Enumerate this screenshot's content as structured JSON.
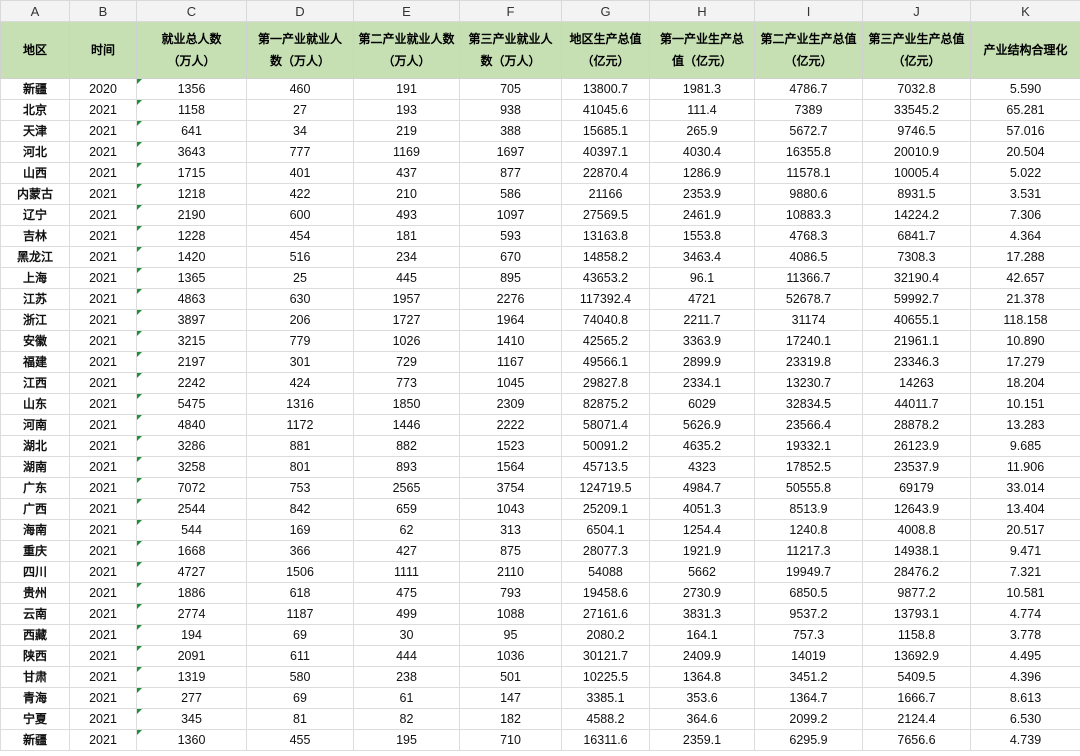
{
  "columns": [
    "A",
    "B",
    "C",
    "D",
    "E",
    "F",
    "G",
    "H",
    "I",
    "J",
    "K"
  ],
  "header": [
    [
      "地区"
    ],
    [
      "时间"
    ],
    [
      "就业总人数",
      "（万人）"
    ],
    [
      "第一产业就业人",
      "数（万人）"
    ],
    [
      "第二产业就业人数",
      "（万人）"
    ],
    [
      "第三产业就业人",
      "数（万人）"
    ],
    [
      "地区生产总值",
      "（亿元）"
    ],
    [
      "第一产业生产总",
      "值（亿元）"
    ],
    [
      "第二产业生产总值",
      "（亿元）"
    ],
    [
      "第三产业生产总值",
      "（亿元）"
    ],
    [
      "产业结构合理化"
    ]
  ],
  "rows": [
    [
      "新疆",
      "2020",
      "1356",
      "460",
      "191",
      "705",
      "13800.7",
      "1981.3",
      "4786.7",
      "7032.8",
      "5.590"
    ],
    [
      "北京",
      "2021",
      "1158",
      "27",
      "193",
      "938",
      "41045.6",
      "111.4",
      "7389",
      "33545.2",
      "65.281"
    ],
    [
      "天津",
      "2021",
      "641",
      "34",
      "219",
      "388",
      "15685.1",
      "265.9",
      "5672.7",
      "9746.5",
      "57.016"
    ],
    [
      "河北",
      "2021",
      "3643",
      "777",
      "1169",
      "1697",
      "40397.1",
      "4030.4",
      "16355.8",
      "20010.9",
      "20.504"
    ],
    [
      "山西",
      "2021",
      "1715",
      "401",
      "437",
      "877",
      "22870.4",
      "1286.9",
      "11578.1",
      "10005.4",
      "5.022"
    ],
    [
      "内蒙古",
      "2021",
      "1218",
      "422",
      "210",
      "586",
      "21166",
      "2353.9",
      "9880.6",
      "8931.5",
      "3.531"
    ],
    [
      "辽宁",
      "2021",
      "2190",
      "600",
      "493",
      "1097",
      "27569.5",
      "2461.9",
      "10883.3",
      "14224.2",
      "7.306"
    ],
    [
      "吉林",
      "2021",
      "1228",
      "454",
      "181",
      "593",
      "13163.8",
      "1553.8",
      "4768.3",
      "6841.7",
      "4.364"
    ],
    [
      "黑龙江",
      "2021",
      "1420",
      "516",
      "234",
      "670",
      "14858.2",
      "3463.4",
      "4086.5",
      "7308.3",
      "17.288"
    ],
    [
      "上海",
      "2021",
      "1365",
      "25",
      "445",
      "895",
      "43653.2",
      "96.1",
      "11366.7",
      "32190.4",
      "42.657"
    ],
    [
      "江苏",
      "2021",
      "4863",
      "630",
      "1957",
      "2276",
      "117392.4",
      "4721",
      "52678.7",
      "59992.7",
      "21.378"
    ],
    [
      "浙江",
      "2021",
      "3897",
      "206",
      "1727",
      "1964",
      "74040.8",
      "2211.7",
      "31174",
      "40655.1",
      "118.158"
    ],
    [
      "安徽",
      "2021",
      "3215",
      "779",
      "1026",
      "1410",
      "42565.2",
      "3363.9",
      "17240.1",
      "21961.1",
      "10.890"
    ],
    [
      "福建",
      "2021",
      "2197",
      "301",
      "729",
      "1167",
      "49566.1",
      "2899.9",
      "23319.8",
      "23346.3",
      "17.279"
    ],
    [
      "江西",
      "2021",
      "2242",
      "424",
      "773",
      "1045",
      "29827.8",
      "2334.1",
      "13230.7",
      "14263",
      "18.204"
    ],
    [
      "山东",
      "2021",
      "5475",
      "1316",
      "1850",
      "2309",
      "82875.2",
      "6029",
      "32834.5",
      "44011.7",
      "10.151"
    ],
    [
      "河南",
      "2021",
      "4840",
      "1172",
      "1446",
      "2222",
      "58071.4",
      "5626.9",
      "23566.4",
      "28878.2",
      "13.283"
    ],
    [
      "湖北",
      "2021",
      "3286",
      "881",
      "882",
      "1523",
      "50091.2",
      "4635.2",
      "19332.1",
      "26123.9",
      "9.685"
    ],
    [
      "湖南",
      "2021",
      "3258",
      "801",
      "893",
      "1564",
      "45713.5",
      "4323",
      "17852.5",
      "23537.9",
      "11.906"
    ],
    [
      "广东",
      "2021",
      "7072",
      "753",
      "2565",
      "3754",
      "124719.5",
      "4984.7",
      "50555.8",
      "69179",
      "33.014"
    ],
    [
      "广西",
      "2021",
      "2544",
      "842",
      "659",
      "1043",
      "25209.1",
      "4051.3",
      "8513.9",
      "12643.9",
      "13.404"
    ],
    [
      "海南",
      "2021",
      "544",
      "169",
      "62",
      "313",
      "6504.1",
      "1254.4",
      "1240.8",
      "4008.8",
      "20.517"
    ],
    [
      "重庆",
      "2021",
      "1668",
      "366",
      "427",
      "875",
      "28077.3",
      "1921.9",
      "11217.3",
      "14938.1",
      "9.471"
    ],
    [
      "四川",
      "2021",
      "4727",
      "1506",
      "1111",
      "2110",
      "54088",
      "5662",
      "19949.7",
      "28476.2",
      "7.321"
    ],
    [
      "贵州",
      "2021",
      "1886",
      "618",
      "475",
      "793",
      "19458.6",
      "2730.9",
      "6850.5",
      "9877.2",
      "10.581"
    ],
    [
      "云南",
      "2021",
      "2774",
      "1187",
      "499",
      "1088",
      "27161.6",
      "3831.3",
      "9537.2",
      "13793.1",
      "4.774"
    ],
    [
      "西藏",
      "2021",
      "194",
      "69",
      "30",
      "95",
      "2080.2",
      "164.1",
      "757.3",
      "1158.8",
      "3.778"
    ],
    [
      "陕西",
      "2021",
      "2091",
      "611",
      "444",
      "1036",
      "30121.7",
      "2409.9",
      "14019",
      "13692.9",
      "4.495"
    ],
    [
      "甘肃",
      "2021",
      "1319",
      "580",
      "238",
      "501",
      "10225.5",
      "1364.8",
      "3451.2",
      "5409.5",
      "4.396"
    ],
    [
      "青海",
      "2021",
      "277",
      "69",
      "61",
      "147",
      "3385.1",
      "353.6",
      "1364.7",
      "1666.7",
      "8.613"
    ],
    [
      "宁夏",
      "2021",
      "345",
      "81",
      "82",
      "182",
      "4588.2",
      "364.6",
      "2099.2",
      "2124.4",
      "6.530"
    ],
    [
      "新疆",
      "2021",
      "1360",
      "455",
      "195",
      "710",
      "16311.6",
      "2359.1",
      "6295.9",
      "7656.6",
      "4.739"
    ]
  ]
}
